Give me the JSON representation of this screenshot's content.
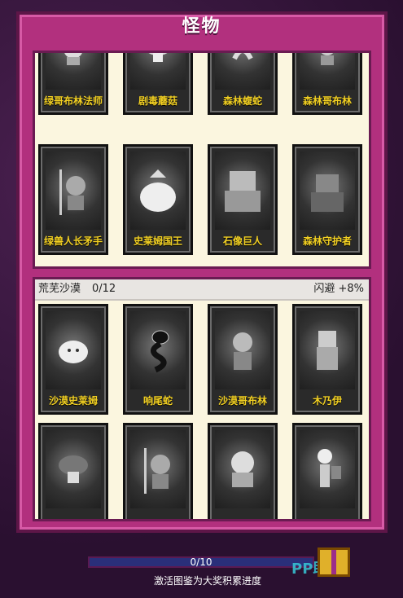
{
  "title": "怪物",
  "section1": {
    "cards": [
      {
        "label": "绿哥布林法师",
        "icon": "goblin-mage-icon"
      },
      {
        "label": "剧毒蘑菇",
        "icon": "mushroom-icon"
      },
      {
        "label": "森林蝮蛇",
        "icon": "snake-icon"
      },
      {
        "label": "森林哥布林",
        "icon": "goblin-icon"
      },
      {
        "label": "绿兽人长矛手",
        "icon": "orc-spearman-icon"
      },
      {
        "label": "史莱姆国王",
        "icon": "slime-king-icon"
      },
      {
        "label": "石像巨人",
        "icon": "stone-golem-icon"
      },
      {
        "label": "森林守护者",
        "icon": "forest-guardian-icon"
      }
    ]
  },
  "section2": {
    "name": "荒芜沙漠",
    "count": "0/12",
    "bonus": "闪避 +8%",
    "cards": [
      {
        "label": "沙漠史莱姆",
        "icon": "slime-icon"
      },
      {
        "label": "响尾蛇",
        "icon": "rattlesnake-icon"
      },
      {
        "label": "沙漠哥布林",
        "icon": "goblin-icon"
      },
      {
        "label": "木乃伊",
        "icon": "mummy-icon"
      },
      {
        "label": "",
        "icon": "mushroom-icon"
      },
      {
        "label": "",
        "icon": "orc-spearman-icon"
      },
      {
        "label": "",
        "icon": "beast-icon"
      },
      {
        "label": "",
        "icon": "skeleton-knight-icon"
      }
    ]
  },
  "footer": {
    "progress_text": "0/10",
    "progress_value": 0,
    "hint": "激活图鉴为大奖积累进度",
    "watermark": "PP助手"
  }
}
